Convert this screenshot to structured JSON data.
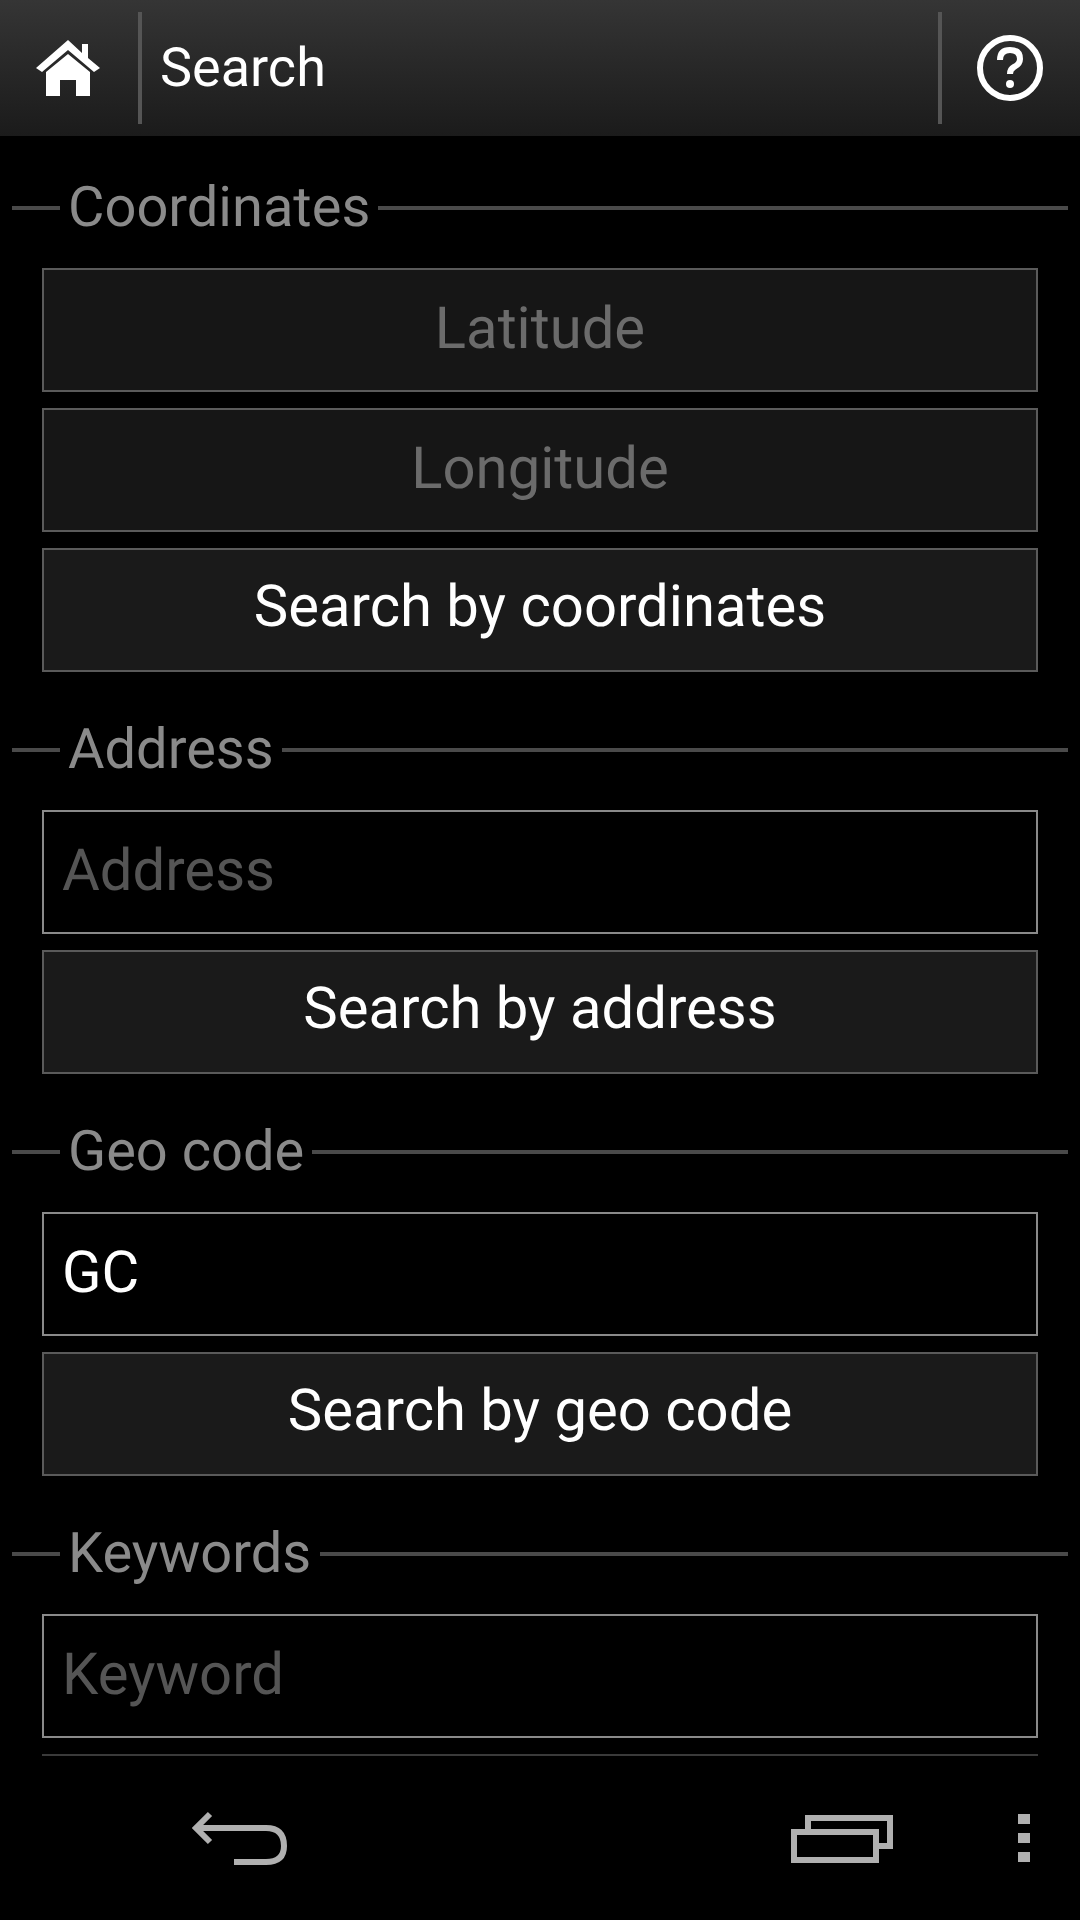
{
  "action_bar": {
    "title": "Search"
  },
  "sections": [
    {
      "title": "Coordinates",
      "items": [
        {
          "kind": "number_field",
          "placeholder": "Latitude"
        },
        {
          "kind": "number_field",
          "placeholder": "Longitude"
        },
        {
          "kind": "button",
          "label": "Search by coordinates"
        }
      ]
    },
    {
      "title": "Address",
      "items": [
        {
          "kind": "text_field",
          "placeholder": "Address"
        },
        {
          "kind": "button",
          "label": "Search by address"
        }
      ]
    },
    {
      "title": "Geo code",
      "items": [
        {
          "kind": "text_field",
          "value": "GC"
        },
        {
          "kind": "button",
          "label": "Search by geo code"
        }
      ]
    },
    {
      "title": "Keywords",
      "items": [
        {
          "kind": "text_field",
          "placeholder": "Keyword"
        }
      ]
    }
  ]
}
